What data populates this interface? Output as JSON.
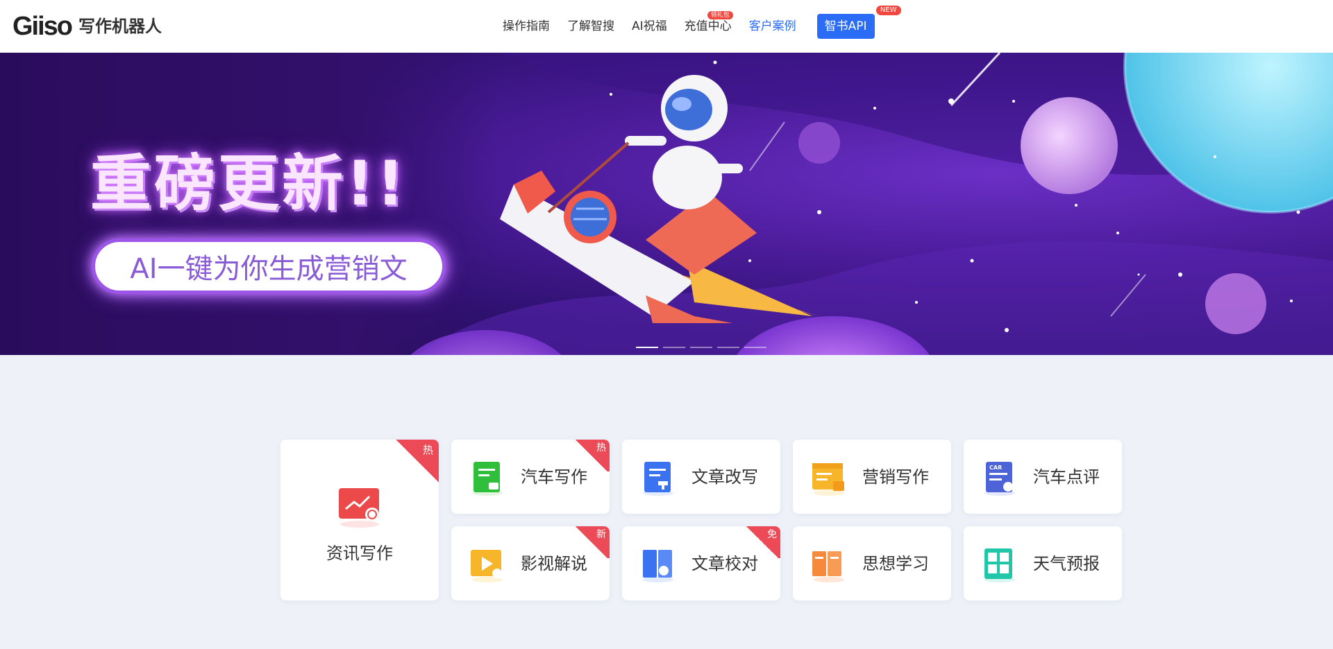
{
  "header": {
    "logo_mark": "Giiso",
    "logo_name": "写作机器人",
    "nav": [
      {
        "label": "操作指南",
        "badge": ""
      },
      {
        "label": "了解智搜",
        "badge": ""
      },
      {
        "label": "AI祝福",
        "badge": ""
      },
      {
        "label": "充值中心",
        "badge": "领礼包"
      },
      {
        "label": "客户案例",
        "badge": "",
        "active": true
      }
    ],
    "api_button": {
      "label": "智书API",
      "badge": "NEW"
    }
  },
  "banner": {
    "headline": "重磅更新!!",
    "pill_text": "AI一键为你生成营销文",
    "slides": 5,
    "active_slide": 1
  },
  "cards": {
    "featured": {
      "label": "资讯写作",
      "tag": "热",
      "icon": "news-writing-icon"
    },
    "items": [
      {
        "label": "汽车写作",
        "tag": "热",
        "icon": "car-writing-icon"
      },
      {
        "label": "文章改写",
        "tag": "",
        "icon": "article-rewrite-icon"
      },
      {
        "label": "营销写作",
        "tag": "",
        "icon": "marketing-writing-icon"
      },
      {
        "label": "汽车点评",
        "tag": "",
        "icon": "car-review-icon"
      },
      {
        "label": "影视解说",
        "tag": "新",
        "icon": "video-commentary-icon"
      },
      {
        "label": "文章校对",
        "tag": "免",
        "icon": "article-proofread-icon"
      },
      {
        "label": "思想学习",
        "tag": "",
        "icon": "thought-study-icon"
      },
      {
        "label": "天气预报",
        "tag": "",
        "icon": "weather-forecast-icon"
      }
    ]
  },
  "colors": {
    "accent": "#2a6cf5",
    "badge": "#ec4a56",
    "banner": "#4a1b98"
  }
}
